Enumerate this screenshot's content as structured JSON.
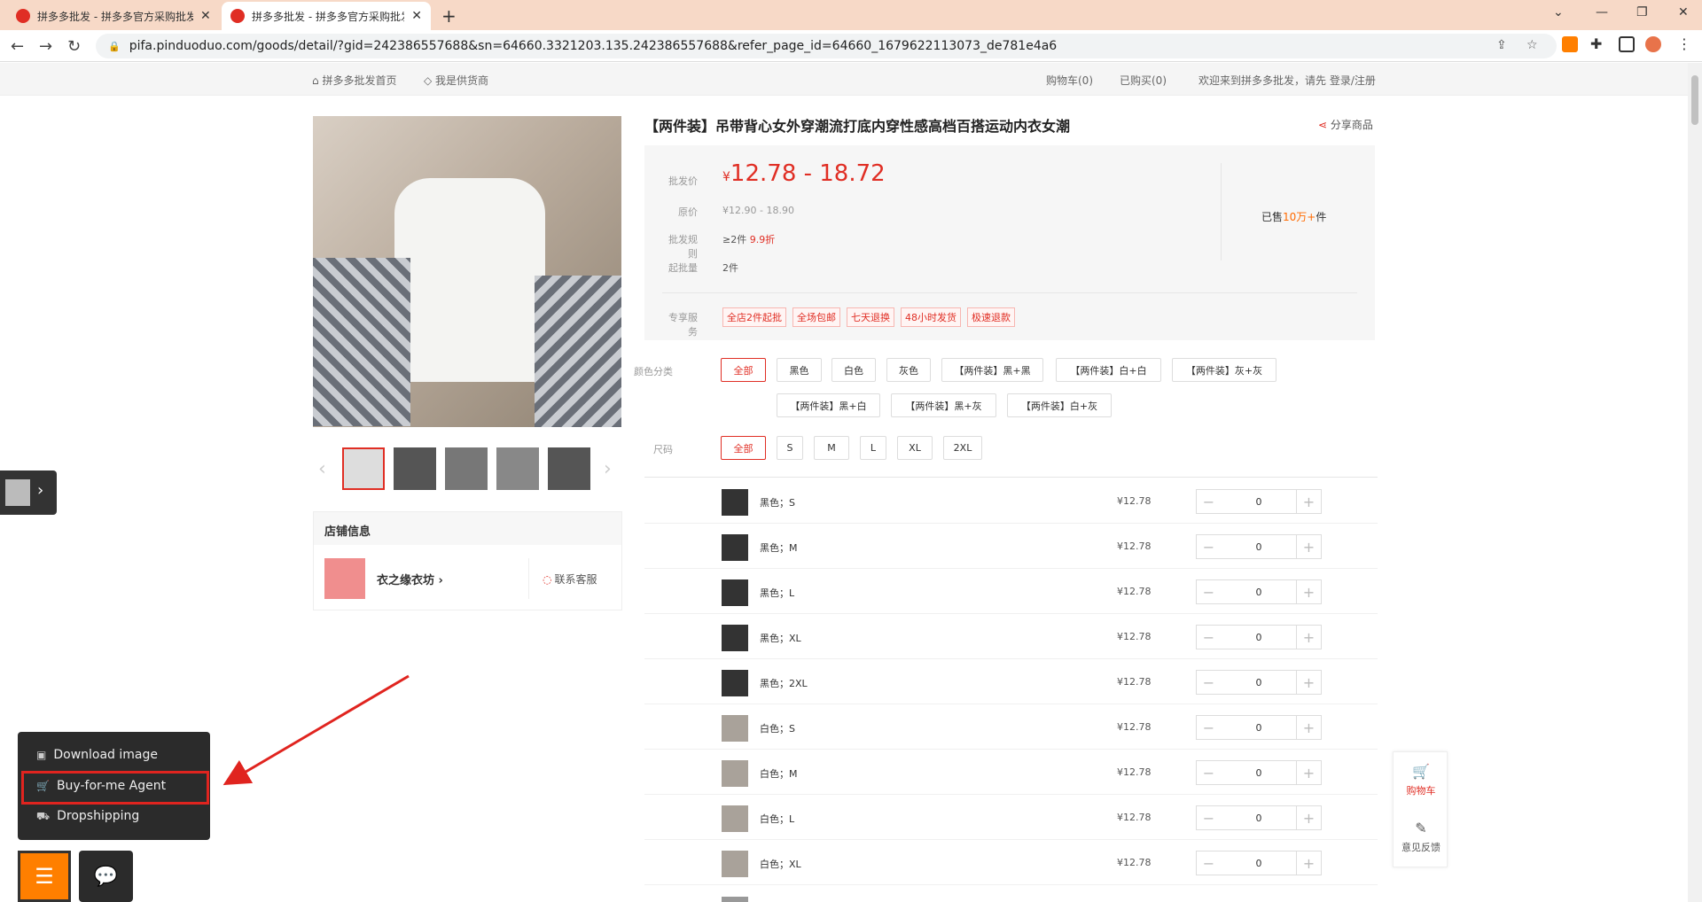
{
  "browser": {
    "tabs": [
      {
        "title": "拼多多批发 - 拼多多官方采购批发"
      },
      {
        "title": "拼多多批发 - 拼多多官方采购批发"
      }
    ],
    "new_tab": "+",
    "url": "pifa.pinduoduo.com/goods/detail/?gid=242386557688&sn=64660.3321203.135.242386557688&refer_page_id=64660_1679622113073_de781e4a6"
  },
  "topnav": {
    "home": "拼多多批发首页",
    "supplier": "我是供货商",
    "cart": "购物车(0)",
    "bought": "已购买(0)",
    "welcome": "欢迎来到拼多多批发，请先 登录/注册"
  },
  "product": {
    "title": "【两件装】吊带背心女外穿潮流打底内穿性感高档百搭运动内衣女潮",
    "share": "分享商品",
    "price_label": "批发价",
    "price_symbol": "¥",
    "price": "12.78 - 18.72",
    "orig_label": "原价",
    "orig_value": "¥12.90 - 18.90",
    "rule_label": "批发规则",
    "rule_value": "≥2件",
    "rule_discount": "9.9折",
    "min_label": "起批量",
    "min_value": "2件",
    "sold_prefix": "已售",
    "sold_count": "10万+",
    "sold_suffix": "件",
    "service_label": "专享服务",
    "services": [
      "全店2件起批",
      "全场包邮",
      "七天退换",
      "48小时发货",
      "极速退款"
    ]
  },
  "options": {
    "color_label": "颜色分类",
    "colors": [
      "全部",
      "黑色",
      "白色",
      "灰色",
      "【两件装】黑+黑",
      "【两件装】白+白",
      "【两件装】灰+灰",
      "【两件装】黑+白",
      "【两件装】黑+灰",
      "【两件装】白+灰"
    ],
    "size_label": "尺码",
    "sizes": [
      "全部",
      "S",
      "M",
      "L",
      "XL",
      "2XL"
    ]
  },
  "sku_rows": [
    {
      "name": "黑色；S",
      "price": "¥12.78",
      "qty": "0"
    },
    {
      "name": "黑色；M",
      "price": "¥12.78",
      "qty": "0"
    },
    {
      "name": "黑色；L",
      "price": "¥12.78",
      "qty": "0"
    },
    {
      "name": "黑色；XL",
      "price": "¥12.78",
      "qty": "0"
    },
    {
      "name": "黑色；2XL",
      "price": "¥12.78",
      "qty": "0"
    },
    {
      "name": "白色；S",
      "price": "¥12.78",
      "qty": "0"
    },
    {
      "name": "白色；M",
      "price": "¥12.78",
      "qty": "0"
    },
    {
      "name": "白色；L",
      "price": "¥12.78",
      "qty": "0"
    },
    {
      "name": "白色；XL",
      "price": "¥12.78",
      "qty": "0"
    }
  ],
  "shop": {
    "header": "店铺信息",
    "name": "衣之缘衣坊",
    "contact": "联系客服",
    "logo_text": "衣之缘衣坊"
  },
  "float": {
    "cart": "购物车",
    "feedback": "意见反馈"
  },
  "popup": {
    "download": "Download image",
    "agent": "Buy-for-me Agent",
    "dropship": "Dropshipping"
  },
  "colors": {
    "accent": "#e02e24",
    "orange": "#ff7f00",
    "highlight": "#e0241f"
  }
}
